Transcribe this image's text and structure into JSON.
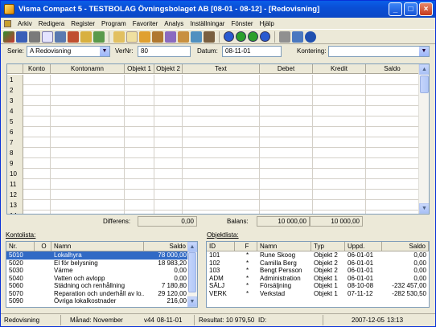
{
  "window": {
    "title": "Visma Compact 5 - TESTBOLAG Övningsbolaget AB [08-01 - 08-12] - [Redovisning]"
  },
  "menu": [
    "Arkiv",
    "Redigera",
    "Register",
    "Program",
    "Favoriter",
    "Analys",
    "Inställningar",
    "Fönster",
    "Hjälp"
  ],
  "form": {
    "serie_label": "Serie:",
    "serie_value": "A Redovisning",
    "vernr_label": "VerNr:",
    "vernr_value": "80",
    "datum_label": "Datum:",
    "datum_value": "08-11-01",
    "kontering_label": "Kontering:",
    "kontering_value": ""
  },
  "grid": {
    "headers": [
      "Konto",
      "Kontonamn",
      "Objekt 1",
      "Objekt 2",
      "Text",
      "Debet",
      "Kredit",
      "Saldo"
    ],
    "row_numbers": [
      "1",
      "2",
      "3",
      "4",
      "5",
      "6",
      "7",
      "8",
      "9",
      "10",
      "11",
      "12",
      "13",
      "14"
    ]
  },
  "totals": {
    "diff_label": "Differens:",
    "diff_value": "0,00",
    "balans_label": "Balans:",
    "debet_value": "10 000,00",
    "kredit_value": "10 000,00"
  },
  "kontolista": {
    "title": "Kontolista:",
    "headers": [
      "Nr.",
      "O",
      "Namn",
      "Saldo"
    ],
    "rows": [
      [
        "5010",
        "",
        "Lokalhyra",
        "78 000,00"
      ],
      [
        "5020",
        "",
        "El för belysning",
        "18 983,20"
      ],
      [
        "5030",
        "",
        "Värme",
        "0,00"
      ],
      [
        "5040",
        "",
        "Vatten och avlopp",
        "0,00"
      ],
      [
        "5060",
        "",
        "Städning och renhållning",
        "7 180,80"
      ],
      [
        "5070",
        "",
        "Reparation och underhåll av lo...",
        "29 120,00"
      ],
      [
        "5090",
        "",
        "Övriga lokalkostnader",
        "216,00"
      ]
    ],
    "selected_index": 0
  },
  "objektlista": {
    "title": "Objektlista:",
    "headers": [
      "ID",
      "F",
      "Namn",
      "Typ",
      "Uppd.",
      "Saldo"
    ],
    "rows": [
      [
        "101",
        "*",
        "Rune Skoog",
        "Objekt 2",
        "06-01-01",
        "0,00"
      ],
      [
        "102",
        "*",
        "Camilla Berg",
        "Objekt 2",
        "06-01-01",
        "0,00"
      ],
      [
        "103",
        "*",
        "Bengt Persson",
        "Objekt 2",
        "06-01-01",
        "0,00"
      ],
      [
        "ADM",
        "*",
        "Administration",
        "Objekt 1",
        "06-01-01",
        "0,00"
      ],
      [
        "SÄLJ",
        "*",
        "Försäljning",
        "Objekt 1",
        "08-10-08",
        "-232 457,00"
      ],
      [
        "VERK",
        "*",
        "Verkstad",
        "Objekt 1",
        "07-11-12",
        "-282 530,50"
      ]
    ]
  },
  "status": {
    "module": "Redovisning",
    "month_label": "Månad: November",
    "version": "v44",
    "date1": "08-11-01",
    "result": "Resultat:  10 979,50",
    "id_label": "ID:",
    "date2": "2007-12-05",
    "time": "13:13"
  },
  "colors": {
    "titlebar": "#0a5ee8",
    "selection": "#316ac5",
    "window_bg": "#ece9d8"
  }
}
